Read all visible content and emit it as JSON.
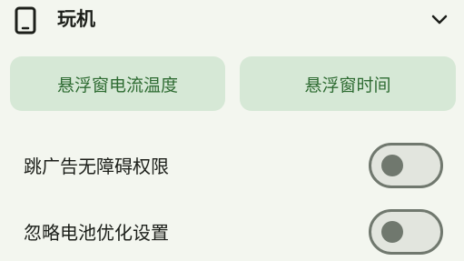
{
  "section": {
    "icon": "phone-icon",
    "title": "玩机",
    "collapse_icon": "chevron-down-icon"
  },
  "chips": [
    {
      "label": "悬浮窗电流温度"
    },
    {
      "label": "悬浮窗时间"
    }
  ],
  "settings": [
    {
      "label": "跳广告无障碍权限",
      "enabled": false
    },
    {
      "label": "忽略电池优化设置",
      "enabled": false
    }
  ],
  "colors": {
    "background": "#f3f6ef",
    "chip_bg": "#d6e8d6",
    "chip_text": "#2e6b32",
    "switch_outline": "#70786e",
    "switch_track": "#e2e5de"
  }
}
